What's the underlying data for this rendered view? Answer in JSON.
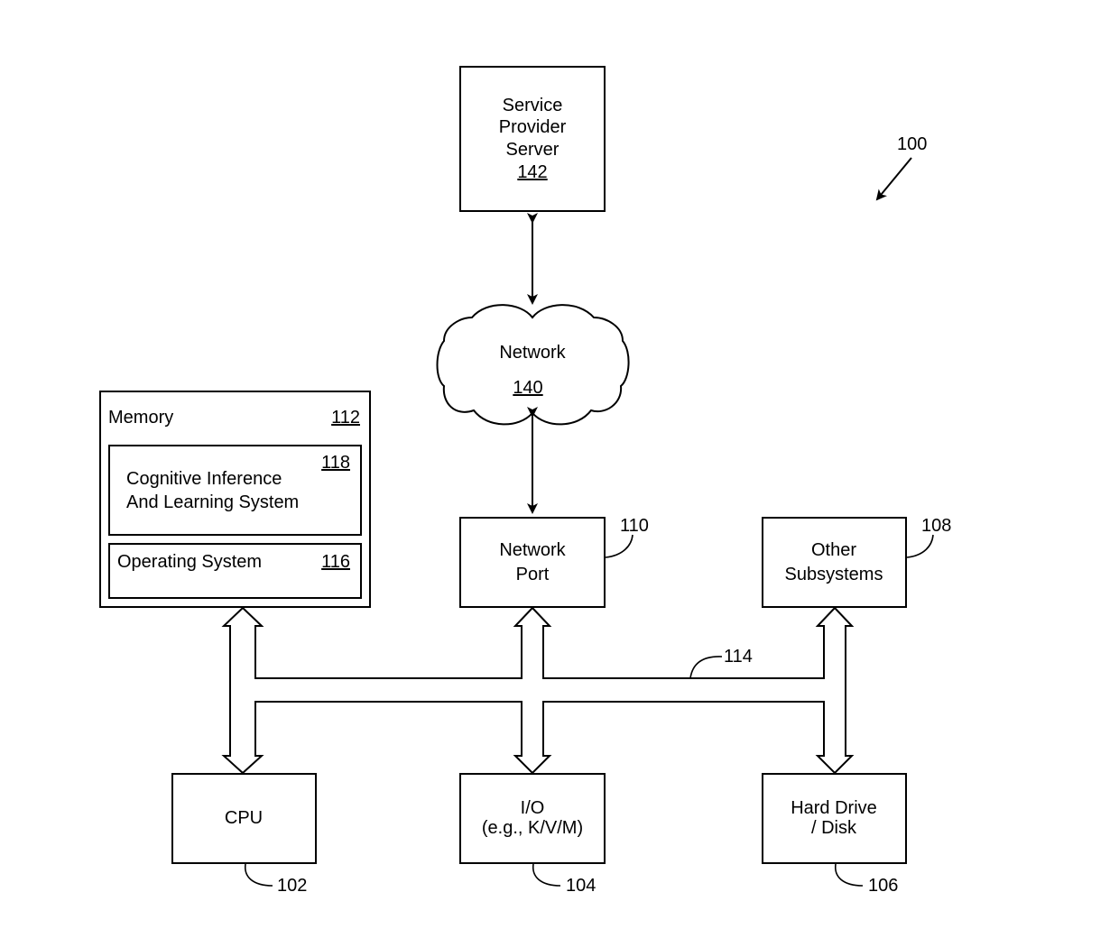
{
  "figure": {
    "ref": "100",
    "components": {
      "service_provider_server": {
        "lines": [
          "Service",
          "Provider",
          "Server"
        ],
        "ref": "142"
      },
      "network": {
        "label": "Network",
        "ref": "140"
      },
      "memory": {
        "label": "Memory",
        "ref": "112"
      },
      "cognitive_system": {
        "lines": [
          "Cognitive Inference",
          "And Learning System"
        ],
        "ref": "118"
      },
      "operating_system": {
        "label": "Operating System",
        "ref": "116"
      },
      "network_port": {
        "lines": [
          "Network",
          "Port"
        ],
        "ref": "110"
      },
      "other_subsystems": {
        "lines": [
          "Other",
          "Subsystems"
        ],
        "ref": "108"
      },
      "bus": {
        "ref": "114"
      },
      "cpu": {
        "label": "CPU",
        "ref": "102"
      },
      "io": {
        "lines": [
          "I/O",
          "(e.g., K/V/M)"
        ],
        "ref": "104"
      },
      "hard_drive": {
        "lines": [
          "Hard Drive",
          "/ Disk"
        ],
        "ref": "106"
      }
    },
    "connections": [
      {
        "from": "service_provider_server",
        "to": "network",
        "type": "bidirectional"
      },
      {
        "from": "network",
        "to": "network_port",
        "type": "bidirectional"
      },
      {
        "from": "memory",
        "to": "bus",
        "type": "bidirectional-bus"
      },
      {
        "from": "network_port",
        "to": "bus",
        "type": "bidirectional-bus"
      },
      {
        "from": "other_subsystems",
        "to": "bus",
        "type": "bidirectional-bus"
      },
      {
        "from": "cpu",
        "to": "bus",
        "type": "bidirectional-bus"
      },
      {
        "from": "io",
        "to": "bus",
        "type": "bidirectional-bus"
      },
      {
        "from": "hard_drive",
        "to": "bus",
        "type": "bidirectional-bus"
      }
    ]
  }
}
